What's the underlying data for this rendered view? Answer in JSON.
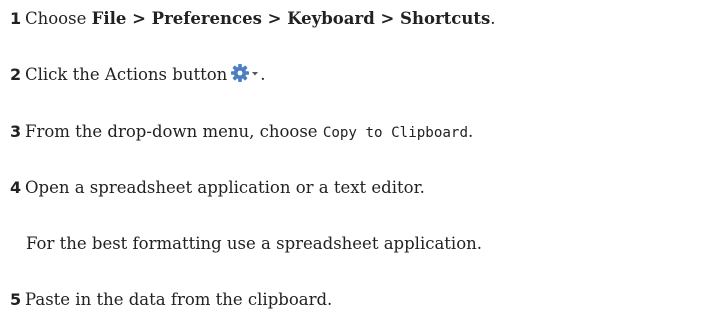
{
  "steps": [
    {
      "number": "1",
      "pre": "Choose ",
      "bold": "File > Preferences > Keyboard > Shortcuts",
      "post": "."
    },
    {
      "number": "2",
      "pre": "Click the Actions button",
      "icon": "gear-with-dropdown-icon",
      "post": "."
    },
    {
      "number": "3",
      "pre": "From the drop-down menu, choose ",
      "code": "Copy to Clipboard",
      "post": "."
    },
    {
      "number": "4",
      "text": "Open a spreadsheet application or a text editor."
    },
    {
      "note": "For the best formatting use a spreadsheet application."
    },
    {
      "number": "5",
      "text": "Paste in the data from the clipboard."
    }
  ],
  "colors": {
    "text": "#222222",
    "gear_icon": "#4a7fc1"
  }
}
